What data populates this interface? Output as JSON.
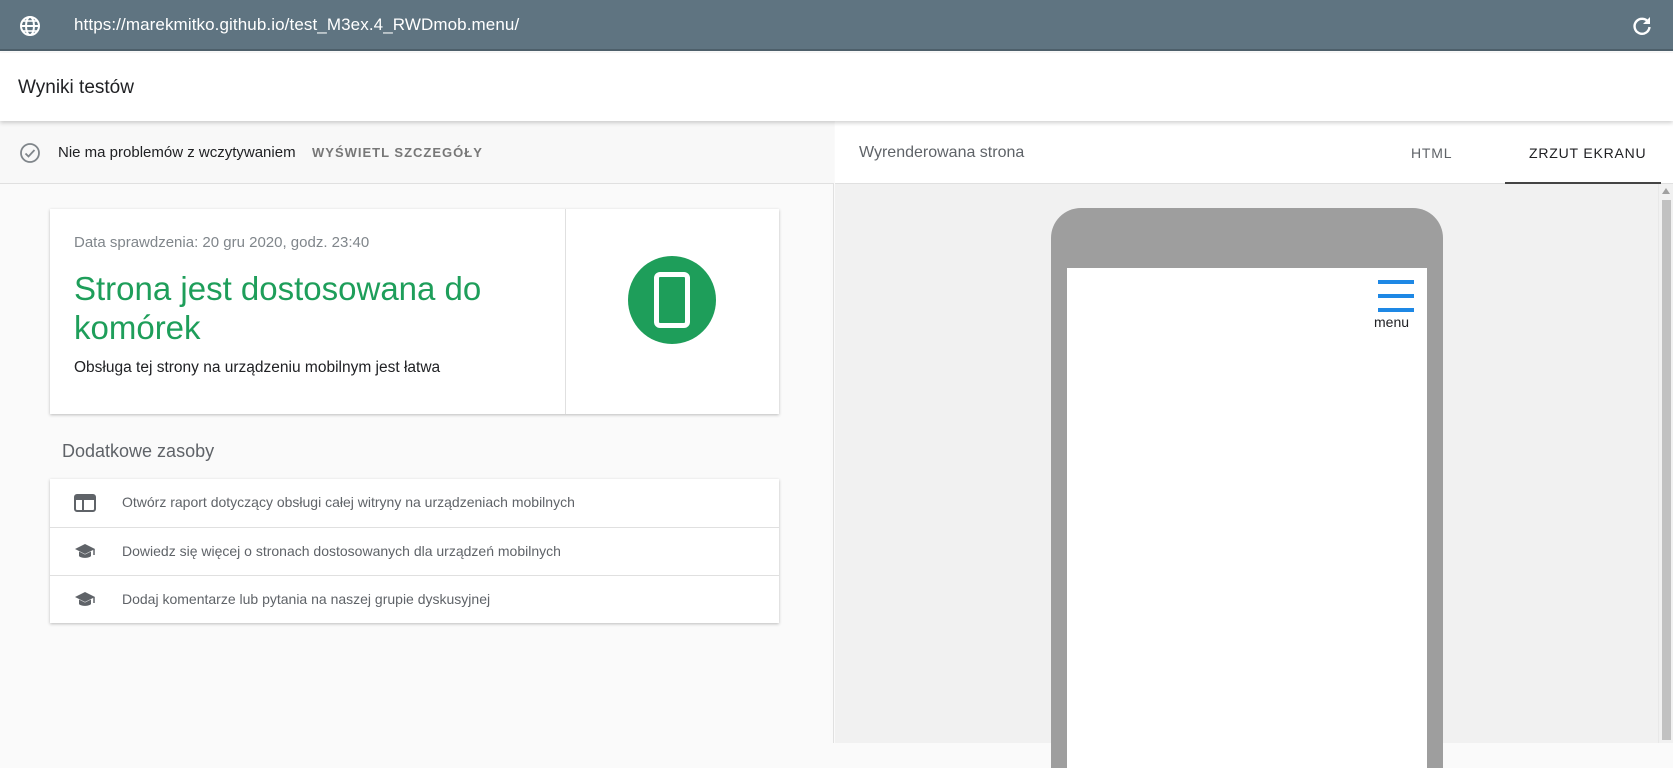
{
  "browser": {
    "url": "https://marekmitko.github.io/test_M3ex.4_RWDmob.menu/",
    "globe_icon": "globe-icon",
    "reload_icon": "reload-icon"
  },
  "header": {
    "title": "Wyniki testów"
  },
  "status": {
    "message": "Nie ma problemów z wczytywaniem",
    "details_label": "WYŚWIETL SZCZEGÓŁY",
    "icon": "check-circle-icon"
  },
  "result": {
    "date": "Data sprawdzenia: 20 gru 2020, godz. 23:40",
    "headline": "Strona jest dostosowana do komórek",
    "subtitle": "Obsługa tej strony na urządzeniu mobilnym jest łatwa",
    "accent_color": "#1e9e5a",
    "icon": "mobile-phone-icon"
  },
  "resources": {
    "title": "Dodatkowe zasoby",
    "items": [
      {
        "label": "Otwórz raport dotyczący obsługi całej witryny na urządzeniach mobilnych",
        "icon": "report-window-icon"
      },
      {
        "label": "Dowiedz się więcej o stronach dostosowanych dla urządzeń mobilnych",
        "icon": "school-cap-icon"
      },
      {
        "label": "Dodaj komentarze lub pytania na naszej grupie dyskusyjnej",
        "icon": "school-cap-icon"
      }
    ]
  },
  "rendered": {
    "label": "Wyrenderowana strona",
    "tabs": [
      {
        "label": "HTML"
      },
      {
        "label": "ZRZUT EKRANU",
        "active": true
      }
    ],
    "screenshot": {
      "menu_label": "menu",
      "menu_color": "#1e88e5"
    }
  }
}
